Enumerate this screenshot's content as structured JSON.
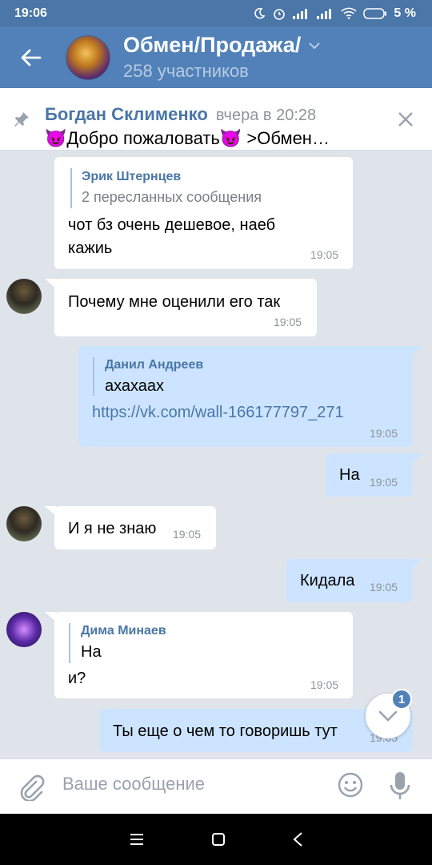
{
  "status_bar": {
    "time": "19:06",
    "battery": "5 %"
  },
  "header": {
    "title": "Обмен/Продажа/",
    "subtitle": "258 участников"
  },
  "pinned": {
    "author": "Богдан Склименко",
    "time": "вчера в 20:28",
    "text": "😈Добро пожаловать😈 >Обмен…"
  },
  "messages": [
    {
      "direction": "in",
      "forward_author": "Эрик Штернцев",
      "forward_info": "2 пересланных сообщения",
      "lines": [
        "чот бз очень дешевое, наеб",
        "кажиь"
      ],
      "time": "19:05"
    },
    {
      "direction": "in",
      "text": "Почему мне оценили его так",
      "time": "19:05"
    },
    {
      "direction": "out",
      "forward_author": "Данил Андреев",
      "forward_text": "ахахаах",
      "link": "https://vk.com/wall-166177797_271",
      "time": "19:05"
    },
    {
      "direction": "out",
      "text": "На",
      "time": "19:05"
    },
    {
      "direction": "in",
      "text": "И я не знаю",
      "time": "19:05"
    },
    {
      "direction": "out",
      "text": "Кидала",
      "time": "19:05"
    },
    {
      "direction": "in",
      "forward_author": "Дима Минаев",
      "forward_text": "На",
      "text": "и?",
      "time": "19:05"
    },
    {
      "direction": "out",
      "text": "Ты еще о чем то говоришь тут",
      "time": "19:05"
    }
  ],
  "scroll_down": {
    "unread_count": "1"
  },
  "composer": {
    "placeholder": "Ваше сообщение"
  },
  "colors": {
    "header": "#5181b8",
    "status_bar": "#4a76a8",
    "outgoing_bubble": "#cce4ff",
    "incoming_bubble": "#ffffff",
    "background": "#dfe4ea",
    "accent": "#4a76a8"
  },
  "icons": [
    "back-arrow-icon",
    "chevron-down-icon",
    "pin-icon",
    "close-icon",
    "scroll-down-icon",
    "attach-icon",
    "emoji-icon",
    "mic-icon",
    "menu-icon",
    "home-icon",
    "back-icon"
  ]
}
